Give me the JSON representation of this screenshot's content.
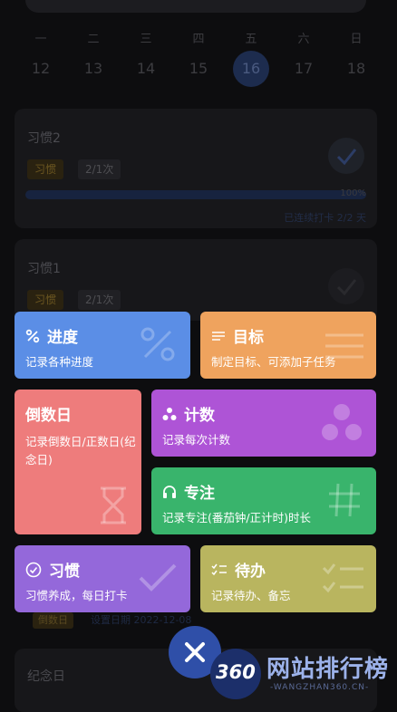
{
  "calendar": {
    "weekdays": [
      "一",
      "二",
      "三",
      "四",
      "五",
      "六",
      "日"
    ],
    "dates": [
      "12",
      "13",
      "14",
      "15",
      "16",
      "17",
      "18"
    ],
    "selected_index": 4
  },
  "habits": [
    {
      "title": "习惯2",
      "tag1": "习惯",
      "tag2": "2/1次",
      "progress_label": "100%",
      "progress": 1.0,
      "done_text": "已连续打卡 2/2 天"
    },
    {
      "title": "习惯1",
      "tag1": "习惯",
      "tag2": "2/1次"
    }
  ],
  "underlay": {
    "countdown_tag": "倒数日",
    "countdown_date": "设置日期 2022-12-08",
    "card_title": "纪念日"
  },
  "menu": {
    "progress": {
      "title": "进度",
      "desc": "记录各种进度",
      "icon": "percent-icon",
      "color": "#5b8ee6"
    },
    "goal": {
      "title": "目标",
      "desc": "制定目标、可添加子任务",
      "icon": "lines-icon",
      "color": "#efa35e"
    },
    "countdown": {
      "title": "倒数日",
      "desc": "记录倒数日/正数日(纪念日)",
      "icon": "hourglass-icon",
      "color": "#ee7c7c"
    },
    "count": {
      "title": "计数",
      "desc": "记录每次计数",
      "icon": "dots-icon",
      "color": "#ae54d6"
    },
    "focus": {
      "title": "专注",
      "desc": "记录专注(番茄钟/正计时)时长",
      "icon": "headphones-icon",
      "color": "#39b46c"
    },
    "habit": {
      "title": "习惯",
      "desc": "习惯养成，每日打卡",
      "icon": "check-circle-icon",
      "color": "#9468da"
    },
    "todo": {
      "title": "待办",
      "desc": "记录待办、备忘",
      "icon": "checklist-icon",
      "color": "#b9b55f"
    }
  },
  "fab": {
    "icon": "close-icon",
    "color": "#2f4fa8"
  },
  "watermark": {
    "logo": "360",
    "name": "网站排行榜",
    "url": "-WANGZHAN360.CN-"
  }
}
